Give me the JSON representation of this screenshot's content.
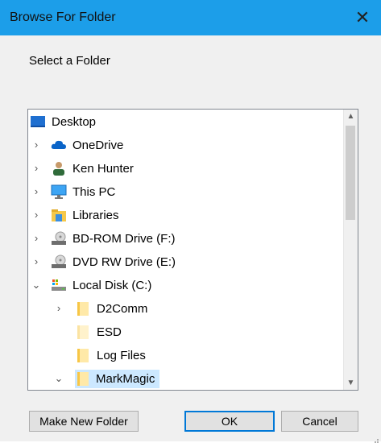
{
  "window": {
    "title": "Browse For Folder",
    "close_glyph": "✕"
  },
  "prompt": "Select a Folder",
  "tree": {
    "items": [
      {
        "label": "Desktop",
        "icon": "desktop-icon",
        "chevron": ""
      },
      {
        "label": "OneDrive",
        "icon": "onedrive-icon",
        "chevron": "›"
      },
      {
        "label": "Ken Hunter",
        "icon": "user-icon",
        "chevron": "›"
      },
      {
        "label": "This PC",
        "icon": "this-pc-icon",
        "chevron": "›"
      },
      {
        "label": "Libraries",
        "icon": "libraries-icon",
        "chevron": "›"
      },
      {
        "label": "BD-ROM Drive (F:)",
        "icon": "optical-drive-icon",
        "chevron": "›"
      },
      {
        "label": "DVD RW Drive (E:)",
        "icon": "optical-drive-icon",
        "chevron": "›"
      },
      {
        "label": "Local Disk (C:)",
        "icon": "local-disk-icon",
        "chevron": "⌄"
      },
      {
        "label": "D2Comm",
        "icon": "folder-icon",
        "chevron": "›"
      },
      {
        "label": "ESD",
        "icon": "folder-icon",
        "chevron": ""
      },
      {
        "label": "Log Files",
        "icon": "folder-icon",
        "chevron": ""
      },
      {
        "label": "MarkMagic",
        "icon": "folder-icon",
        "chevron": "⌄",
        "selected": true
      }
    ]
  },
  "scrollbar": {
    "up_glyph": "▲",
    "down_glyph": "▼"
  },
  "buttons": {
    "new_folder": "Make New Folder",
    "ok": "OK",
    "cancel": "Cancel"
  },
  "colors": {
    "titlebar": "#1c9ee9",
    "selection": "#cce8ff",
    "focus_border": "#0078d7"
  }
}
